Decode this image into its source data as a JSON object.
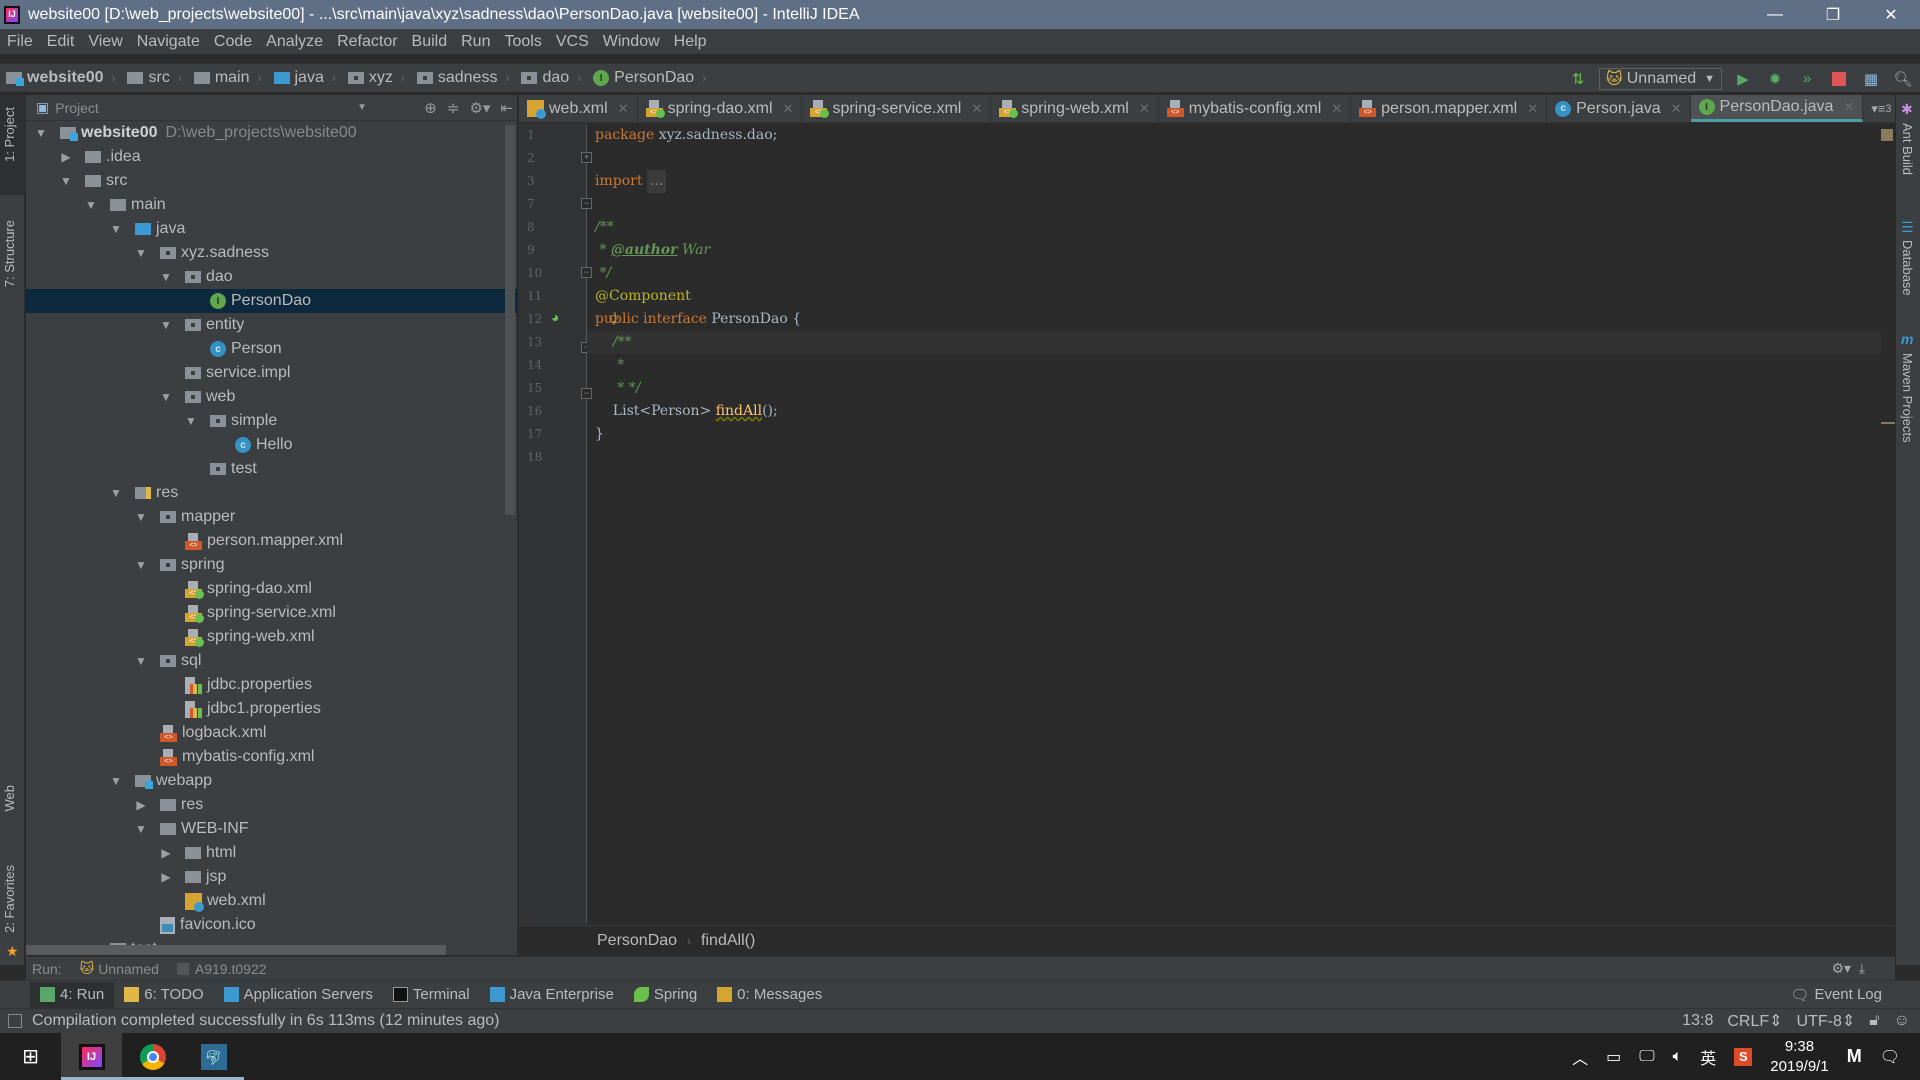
{
  "window": {
    "title": "website00 [D:\\web_projects\\website00] - ...\\src\\main\\java\\xyz\\sadness\\dao\\PersonDao.java [website00] - IntelliJ IDEA",
    "app_icon": "intellij-icon",
    "controls": {
      "minimize": "—",
      "restore": "❐",
      "close": "✕"
    }
  },
  "menu": [
    "File",
    "Edit",
    "View",
    "Navigate",
    "Code",
    "Analyze",
    "Refactor",
    "Build",
    "Run",
    "Tools",
    "VCS",
    "Window",
    "Help"
  ],
  "navbar": {
    "crumbs": [
      {
        "label": "website00",
        "icon": "module-folder-icon"
      },
      {
        "label": "src",
        "icon": "folder-icon"
      },
      {
        "label": "main",
        "icon": "folder-icon"
      },
      {
        "label": "java",
        "icon": "source-folder-icon"
      },
      {
        "label": "xyz",
        "icon": "package-icon"
      },
      {
        "label": "sadness",
        "icon": "package-icon"
      },
      {
        "label": "dao",
        "icon": "package-icon"
      },
      {
        "label": "PersonDao",
        "icon": "interface-icon"
      }
    ],
    "run_config": "Unnamed"
  },
  "left_stripe": {
    "tabs": [
      "1: Project",
      "7: Structure",
      "Web",
      "2: Favorites"
    ]
  },
  "right_stripe": {
    "tabs": [
      "Ant Build",
      "Database",
      "Maven Projects"
    ]
  },
  "project": {
    "header": "Project",
    "tree": [
      {
        "depth": 0,
        "arrow": "down",
        "icon": "module",
        "label": "website00",
        "hint": "D:\\web_projects\\website00",
        "bold": true
      },
      {
        "depth": 1,
        "arrow": "right",
        "icon": "folder",
        "label": ".idea"
      },
      {
        "depth": 1,
        "arrow": "down",
        "icon": "folder",
        "label": "src"
      },
      {
        "depth": 2,
        "arrow": "down",
        "icon": "folder",
        "label": "main"
      },
      {
        "depth": 3,
        "arrow": "down",
        "icon": "source",
        "label": "java"
      },
      {
        "depth": 4,
        "arrow": "down",
        "icon": "package",
        "label": "xyz.sadness"
      },
      {
        "depth": 5,
        "arrow": "down",
        "icon": "package",
        "label": "dao"
      },
      {
        "depth": 6,
        "arrow": "none",
        "icon": "interface",
        "label": "PersonDao",
        "selected": true
      },
      {
        "depth": 5,
        "arrow": "down",
        "icon": "package",
        "label": "entity"
      },
      {
        "depth": 6,
        "arrow": "none",
        "icon": "class",
        "label": "Person"
      },
      {
        "depth": 5,
        "arrow": "none",
        "icon": "package",
        "label": "service.impl"
      },
      {
        "depth": 5,
        "arrow": "down",
        "icon": "package",
        "label": "web"
      },
      {
        "depth": 6,
        "arrow": "down",
        "icon": "package",
        "label": "simple"
      },
      {
        "depth": 7,
        "arrow": "none",
        "icon": "class",
        "label": "Hello"
      },
      {
        "depth": 6,
        "arrow": "none",
        "icon": "package",
        "label": "test"
      },
      {
        "depth": 3,
        "arrow": "down",
        "icon": "resources",
        "label": "res"
      },
      {
        "depth": 4,
        "arrow": "down",
        "icon": "package",
        "label": "mapper"
      },
      {
        "depth": 5,
        "arrow": "none",
        "icon": "xml",
        "label": "person.mapper.xml"
      },
      {
        "depth": 4,
        "arrow": "down",
        "icon": "package",
        "label": "spring"
      },
      {
        "depth": 5,
        "arrow": "none",
        "icon": "spring-xml",
        "label": "spring-dao.xml"
      },
      {
        "depth": 5,
        "arrow": "none",
        "icon": "spring-xml",
        "label": "spring-service.xml"
      },
      {
        "depth": 5,
        "arrow": "none",
        "icon": "spring-xml",
        "label": "spring-web.xml"
      },
      {
        "depth": 4,
        "arrow": "down",
        "icon": "package",
        "label": "sql"
      },
      {
        "depth": 5,
        "arrow": "none",
        "icon": "properties",
        "label": "jdbc.properties"
      },
      {
        "depth": 5,
        "arrow": "none",
        "icon": "properties",
        "label": "jdbc1.properties"
      },
      {
        "depth": 4,
        "arrow": "none",
        "icon": "xml",
        "label": "logback.xml"
      },
      {
        "depth": 4,
        "arrow": "none",
        "icon": "xml",
        "label": "mybatis-config.xml"
      },
      {
        "depth": 3,
        "arrow": "down",
        "icon": "webfolder",
        "label": "webapp"
      },
      {
        "depth": 4,
        "arrow": "right",
        "icon": "folder",
        "label": "res"
      },
      {
        "depth": 4,
        "arrow": "down",
        "icon": "folder",
        "label": "WEB-INF"
      },
      {
        "depth": 5,
        "arrow": "right",
        "icon": "folder",
        "label": "html"
      },
      {
        "depth": 5,
        "arrow": "right",
        "icon": "folder",
        "label": "jsp"
      },
      {
        "depth": 5,
        "arrow": "none",
        "icon": "webxml",
        "label": "web.xml"
      },
      {
        "depth": 4,
        "arrow": "none",
        "icon": "ico",
        "label": "favicon.ico"
      },
      {
        "depth": 2,
        "arrow": "down",
        "icon": "folder",
        "label": "test"
      }
    ]
  },
  "tabs": [
    {
      "label": "web.xml",
      "icon": "webxml"
    },
    {
      "label": "spring-dao.xml",
      "icon": "spring-xml"
    },
    {
      "label": "spring-service.xml",
      "icon": "spring-xml"
    },
    {
      "label": "spring-web.xml",
      "icon": "spring-xml"
    },
    {
      "label": "mybatis-config.xml",
      "icon": "xml"
    },
    {
      "label": "person.mapper.xml",
      "icon": "xml"
    },
    {
      "label": "Person.java",
      "icon": "class"
    },
    {
      "label": "PersonDao.java",
      "icon": "interface",
      "active": true
    }
  ],
  "tabs_overflow": "3",
  "editor": {
    "line_numbers": [
      "1",
      "2",
      "3",
      "7",
      "8",
      "9",
      "10",
      "11",
      "12",
      "13",
      "14",
      "15",
      "16",
      "17",
      "18"
    ],
    "caret_line": 10,
    "lines": [
      [
        {
          "t": "package ",
          "c": "kw"
        },
        {
          "t": "xyz.sadness.dao;",
          "c": ""
        }
      ],
      [],
      [
        {
          "t": "import ",
          "c": "kw"
        },
        {
          "t": "...",
          "c": "foldbox"
        }
      ],
      [],
      [
        {
          "t": "/**",
          "c": "cm"
        }
      ],
      [
        {
          "t": " * ",
          "c": "cm"
        },
        {
          "t": "@author",
          "c": "tag"
        },
        {
          "t": " War",
          "c": "cm"
        }
      ],
      [
        {
          "t": " */",
          "c": "cm"
        }
      ],
      [
        {
          "t": "@Component",
          "c": "an"
        }
      ],
      [
        {
          "t": "public interface ",
          "c": "kw"
        },
        {
          "t": "PersonDao {",
          "c": ""
        }
      ],
      [
        {
          "t": "    /**",
          "c": "cm"
        }
      ],
      [
        {
          "t": "     *",
          "c": "cm"
        }
      ],
      [
        {
          "t": "     * */",
          "c": "cm"
        }
      ],
      [
        {
          "t": "    List<Person> ",
          "c": ""
        },
        {
          "t": "findAll",
          "c": "fn"
        },
        {
          "t": "();",
          "c": ""
        }
      ],
      [
        {
          "t": "}",
          "c": ""
        }
      ],
      []
    ]
  },
  "breadcrumb": [
    "PersonDao",
    "findAll()"
  ],
  "run_bar": {
    "label": "Run:",
    "config": "Unnamed",
    "process": "A919.t0922"
  },
  "tool_windows": [
    {
      "label": "4: Run",
      "icon": "run-icon",
      "active": true
    },
    {
      "label": "6: TODO",
      "icon": "todo-icon"
    },
    {
      "label": "Application Servers",
      "icon": "app-servers-icon"
    },
    {
      "label": "Terminal",
      "icon": "terminal-icon"
    },
    {
      "label": "Java Enterprise",
      "icon": "java-enterprise-icon"
    },
    {
      "label": "Spring",
      "icon": "spring-icon"
    },
    {
      "label": "0: Messages",
      "icon": "messages-icon"
    }
  ],
  "event_log": "Event Log",
  "status": {
    "message": "Compilation completed successfully in 6s 113ms (12 minutes ago)",
    "position": "13:8",
    "line_sep": "CRLF",
    "encoding": "UTF-8"
  },
  "taskbar": {
    "apps": [
      "IntelliJ IDEA",
      "Google Chrome",
      "MySQL Workbench"
    ],
    "ime": "英",
    "time": "9:38",
    "date": "2019/9/1"
  }
}
